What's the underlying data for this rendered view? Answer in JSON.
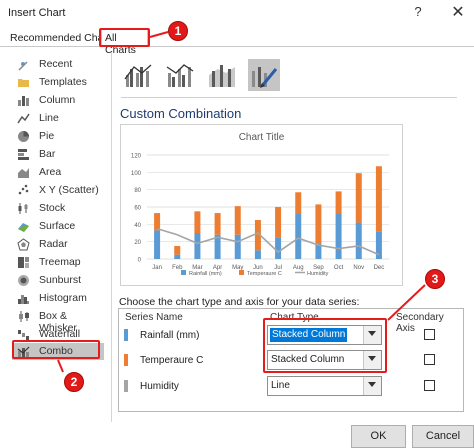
{
  "window": {
    "title": "Insert Chart",
    "help_glyph": "?",
    "close_glyph": "✕"
  },
  "tabs": [
    {
      "label": "Recommended Charts"
    },
    {
      "label": "All Charts"
    }
  ],
  "sidebar": {
    "items": [
      {
        "label": "Recent",
        "icon": "recent-icon"
      },
      {
        "label": "Templates",
        "icon": "templates-folder-icon"
      },
      {
        "label": "Column",
        "icon": "column-chart-icon"
      },
      {
        "label": "Line",
        "icon": "line-chart-icon"
      },
      {
        "label": "Pie",
        "icon": "pie-chart-icon"
      },
      {
        "label": "Bar",
        "icon": "bar-chart-icon"
      },
      {
        "label": "Area",
        "icon": "area-chart-icon"
      },
      {
        "label": "X Y (Scatter)",
        "icon": "scatter-chart-icon"
      },
      {
        "label": "Stock",
        "icon": "stock-chart-icon"
      },
      {
        "label": "Surface",
        "icon": "surface-chart-icon"
      },
      {
        "label": "Radar",
        "icon": "radar-chart-icon"
      },
      {
        "label": "Treemap",
        "icon": "treemap-chart-icon"
      },
      {
        "label": "Sunburst",
        "icon": "sunburst-chart-icon"
      },
      {
        "label": "Histogram",
        "icon": "histogram-chart-icon"
      },
      {
        "label": "Box & Whisker",
        "icon": "box-whisker-chart-icon"
      },
      {
        "label": "Waterfall",
        "icon": "waterfall-chart-icon"
      },
      {
        "label": "Combo",
        "icon": "combo-chart-icon",
        "selected": true
      }
    ]
  },
  "subtypes": [
    {
      "name": "clustered-column-line",
      "selected": false
    },
    {
      "name": "clustered-column-line-secondary-axis",
      "selected": false
    },
    {
      "name": "stacked-area-clustered-column",
      "selected": false
    },
    {
      "name": "custom-combination",
      "selected": true
    }
  ],
  "section_title": "Custom Combination",
  "chart_data": {
    "type": "bar",
    "title": "Chart Title",
    "categories": [
      "Jan",
      "Feb",
      "Mar",
      "Apr",
      "May",
      "Jun",
      "Jul",
      "Aug",
      "Sep",
      "Oct",
      "Nov",
      "Dec"
    ],
    "ylim": [
      0,
      120
    ],
    "yticks": [
      0,
      20,
      40,
      60,
      80,
      100,
      120
    ],
    "series": [
      {
        "name": "Rainfall (mm)",
        "kind": "stacked-column",
        "color": "#5b9bd5",
        "values": [
          33,
          5,
          30,
          28,
          28,
          10,
          25,
          53,
          18,
          53,
          42,
          32
        ]
      },
      {
        "name": "Temperaure C",
        "kind": "stacked-column",
        "color": "#ed7d31",
        "values": [
          20,
          10,
          25,
          25,
          33,
          35,
          35,
          24,
          45,
          25,
          57,
          75
        ]
      },
      {
        "name": "Humidity",
        "kind": "line",
        "color": "#a5a5a5",
        "values": [
          35,
          28,
          18,
          25,
          20,
          30,
          8,
          24,
          16,
          12,
          15,
          5
        ]
      }
    ],
    "legend_position": "bottom",
    "gridlines": true
  },
  "series_config": {
    "caption": "Choose the chart type and axis for your data series:",
    "headers": {
      "series_name": "Series Name",
      "chart_type": "Chart Type",
      "secondary_axis": "Secondary Axis"
    },
    "rows": [
      {
        "name": "Rainfall (mm)",
        "color": "#5b9bd5",
        "chart_type": "Stacked Column",
        "secondary": false,
        "highlighted": true
      },
      {
        "name": "Temperaure C",
        "color": "#ed7d31",
        "chart_type": "Stacked Column",
        "secondary": false,
        "highlighted": false
      },
      {
        "name": "Humidity",
        "color": "#a5a5a5",
        "chart_type": "Line",
        "secondary": false,
        "highlighted": false
      }
    ]
  },
  "buttons": {
    "ok": "OK",
    "cancel": "Cancel"
  },
  "annotations": [
    {
      "number": "1",
      "color": "#e11919"
    },
    {
      "number": "2",
      "color": "#e11919"
    },
    {
      "number": "3",
      "color": "#e11919"
    }
  ]
}
